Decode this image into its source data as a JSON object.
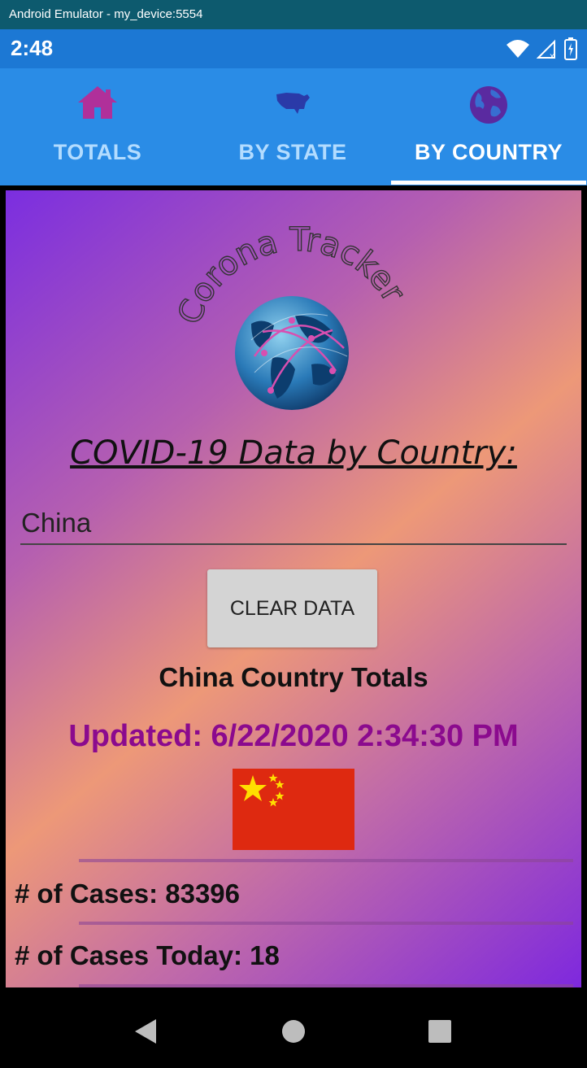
{
  "window": {
    "title": "Android Emulator - my_device:5554"
  },
  "status_bar": {
    "time": "2:48"
  },
  "tabs": [
    {
      "label": "TOTALS",
      "icon": "home-icon",
      "icon_color": "#b0309a"
    },
    {
      "label": "BY STATE",
      "icon": "usa-map-icon",
      "icon_color": "#2a3aa8"
    },
    {
      "label": "BY COUNTRY",
      "icon": "globe-icon",
      "icon_color": "#5a2aa0",
      "selected": true
    }
  ],
  "logo": {
    "text": "Corona Tracker"
  },
  "heading": "COVID-19 Data by Country:",
  "country_input": {
    "value": "China"
  },
  "clear_button": "CLEAR DATA",
  "totals_title": "China Country Totals",
  "updated": "Updated: 6/22/2020 2:34:30 PM",
  "flag": {
    "country": "China",
    "color": "#de2910",
    "star_color": "#ffde00"
  },
  "stats": [
    {
      "label": "# of Cases: 83396"
    },
    {
      "label": "# of Cases Today: 18"
    }
  ],
  "colors": {
    "title_bar": "#0d5a6e",
    "status_bar": "#1c78d4",
    "tab_bar": "#2a8ce6",
    "updated_text": "#8b0a8e"
  }
}
